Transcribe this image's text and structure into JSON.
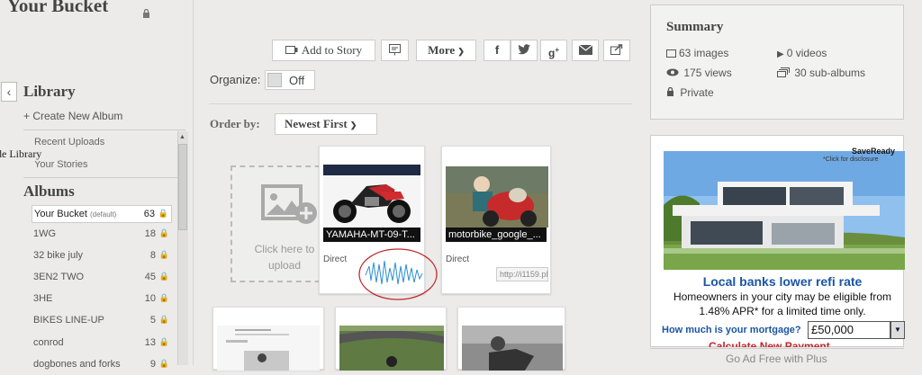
{
  "header": {
    "title": "Your Bucket",
    "lock_icon": "lock-icon"
  },
  "sidebar": {
    "library_heading": "Library",
    "create_album": "+ Create New Album",
    "recent_uploads": "Recent Uploads",
    "your_stories": "Your Stories",
    "hide_library": "de Library",
    "albums_heading": "Albums",
    "albums": [
      {
        "name": "Your Bucket",
        "tag": "(default)",
        "count": "63"
      },
      {
        "name": "1WG",
        "count": "18"
      },
      {
        "name": "32 bike july",
        "count": "8"
      },
      {
        "name": "3EN2 TWO",
        "count": "45"
      },
      {
        "name": "3HE",
        "count": "10"
      },
      {
        "name": "BIKES LINE-UP",
        "count": "5"
      },
      {
        "name": "conrod",
        "count": "13"
      },
      {
        "name": "dogbones and forks",
        "count": "9"
      }
    ]
  },
  "toolbar": {
    "add_to_story": "Add to Story",
    "more": "More",
    "share_icons": [
      "facebook-icon",
      "twitter-icon",
      "google-plus-icon",
      "email-icon",
      "share-icon"
    ],
    "organize_label": "Organize:",
    "organize_state": "Off",
    "order_by_label": "Order by:",
    "order_by_value": "Newest First"
  },
  "upload": {
    "text_line1": "Click here to",
    "text_line2": "upload"
  },
  "photos": [
    {
      "caption": "YAMAHA-MT-09-T...",
      "direct_label": "Direct"
    },
    {
      "caption": "motorbike_google_...",
      "direct_label": "Direct",
      "direct_url": "http://i1159.pl"
    }
  ],
  "summary": {
    "title": "Summary",
    "images": "63 images",
    "videos": "0 videos",
    "views": "175 views",
    "sub_albums": "30 sub-albums",
    "privacy": "Private"
  },
  "ad": {
    "saveready": "SaveReady",
    "saveready_sub": "*Click for disclosure",
    "headline": "Local banks lower refi rate",
    "body_line1": "Homeowners in your city may be eligible from",
    "body_line2": "1.48% APR* for a limited time only.",
    "question": "How much is your mortgage?",
    "amount": "£50,000",
    "cta": "Calculate New Payment",
    "ad_free": "Go Ad Free with Plus"
  }
}
